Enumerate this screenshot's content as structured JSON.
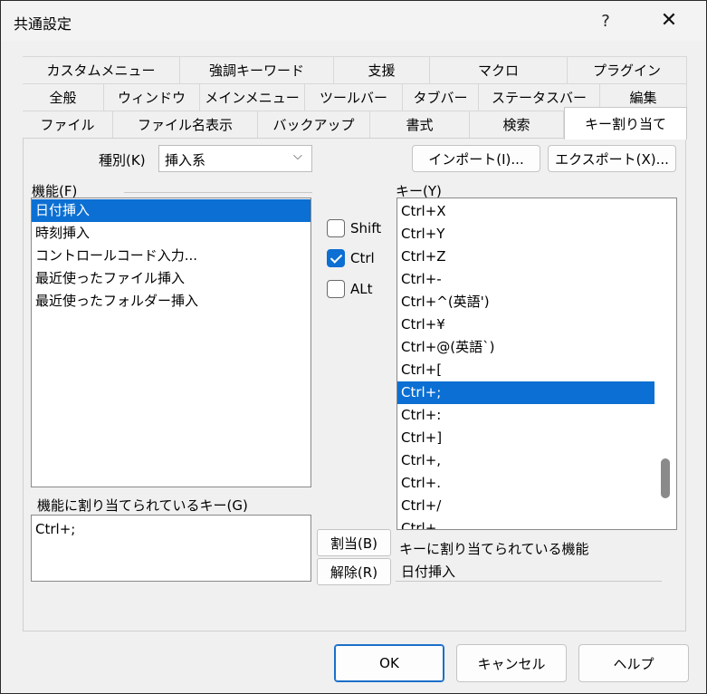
{
  "window": {
    "title": "共通設定",
    "help_glyph": "?",
    "close_glyph": "✕"
  },
  "tabs": {
    "row1": [
      "カスタムメニュー",
      "強調キーワード",
      "支援",
      "マクロ",
      "プラグイン"
    ],
    "row2": [
      "全般",
      "ウィンドウ",
      "メインメニュー",
      "ツールバー",
      "タブバー",
      "ステータスバー",
      "編集"
    ],
    "row3": [
      "ファイル",
      "ファイル名表示",
      "バックアップ",
      "書式",
      "検索",
      "キー割り当て"
    ],
    "active": "キー割り当て"
  },
  "category": {
    "label": "種別(K)",
    "value": "挿入系"
  },
  "import_button": "インポート(I)...",
  "export_button": "エクスポート(X)...",
  "functions": {
    "label": "機能(F)",
    "items": [
      "日付挿入",
      "時刻挿入",
      "コントロールコード入力...",
      "最近使ったファイル挿入",
      "最近使ったフォルダー挿入"
    ],
    "selected_index": 0
  },
  "modifiers": {
    "shift": "Shift",
    "ctrl": "Ctrl",
    "alt": "ALt",
    "shift_checked": false,
    "ctrl_checked": true,
    "alt_checked": false
  },
  "keys": {
    "label": "キー(Y)",
    "items": [
      "Ctrl+X",
      "Ctrl+Y",
      "Ctrl+Z",
      "Ctrl+-",
      "Ctrl+^(英語')",
      "Ctrl+¥",
      "Ctrl+@(英語`)",
      "Ctrl+[",
      "Ctrl+;",
      "Ctrl+:",
      "Ctrl+]",
      "Ctrl+,",
      "Ctrl+.",
      "Ctrl+/",
      "Ctrl+_"
    ],
    "selected_index": 8
  },
  "assigned_keys": {
    "label": "機能に割り当てられているキー(G)",
    "value": "Ctrl+;"
  },
  "assign_button": "割当(B)",
  "remove_button": "解除(R)",
  "assigned_function": {
    "label": "キーに割り当てられている機能",
    "value": "日付挿入"
  },
  "footer": {
    "ok": "OK",
    "cancel": "キャンセル",
    "help": "ヘルプ"
  },
  "colors": {
    "accent": "#0b6fd3",
    "dialog_bg": "#f0f0f0"
  }
}
